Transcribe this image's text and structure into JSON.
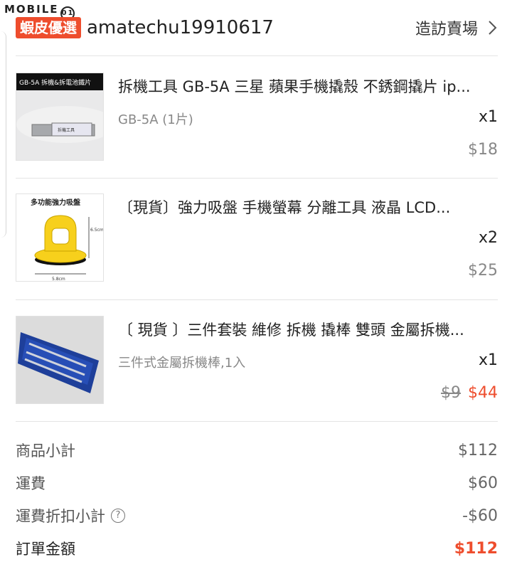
{
  "watermark": "MOBILE01",
  "shop": {
    "badge": "蝦皮優選",
    "name": "amatechu19910617",
    "visit_label": "造訪賣場"
  },
  "items": [
    {
      "name": "拆機工具 GB-5A 三星 蘋果手機撬殼 不銹鋼撬片 ip...",
      "variant": "GB-5A (1片)",
      "qty": "x1",
      "price": "$18",
      "thumb_caption": "GB-5A 拆機&拆電池鐵片",
      "thumb_label": "拆機工具"
    },
    {
      "name": "〔現貨〕強力吸盤 手機螢幕 分離工具 液晶 LCD...",
      "variant": "",
      "qty": "x2",
      "price": "$25",
      "thumb_caption": "多功能強力吸盤",
      "thumb_dim_h": "6.5cm",
      "thumb_dim_w": "5.8cm"
    },
    {
      "name": "〔 現貨 〕三件套裝 維修 拆機 撬棒 雙頭 金屬拆機...",
      "variant": "三件式金屬拆機棒,1入",
      "qty": "x1",
      "price_old": "$9",
      "price_new": "$44"
    }
  ],
  "summary": {
    "subtotal_label": "商品小計",
    "subtotal_value": "$112",
    "shipping_label": "運費",
    "shipping_value": "$60",
    "shipping_discount_label": "運費折扣小計",
    "shipping_discount_value": "-$60",
    "total_label": "訂單金額",
    "total_value": "$112"
  },
  "colors": {
    "accent": "#ee4d2d"
  }
}
